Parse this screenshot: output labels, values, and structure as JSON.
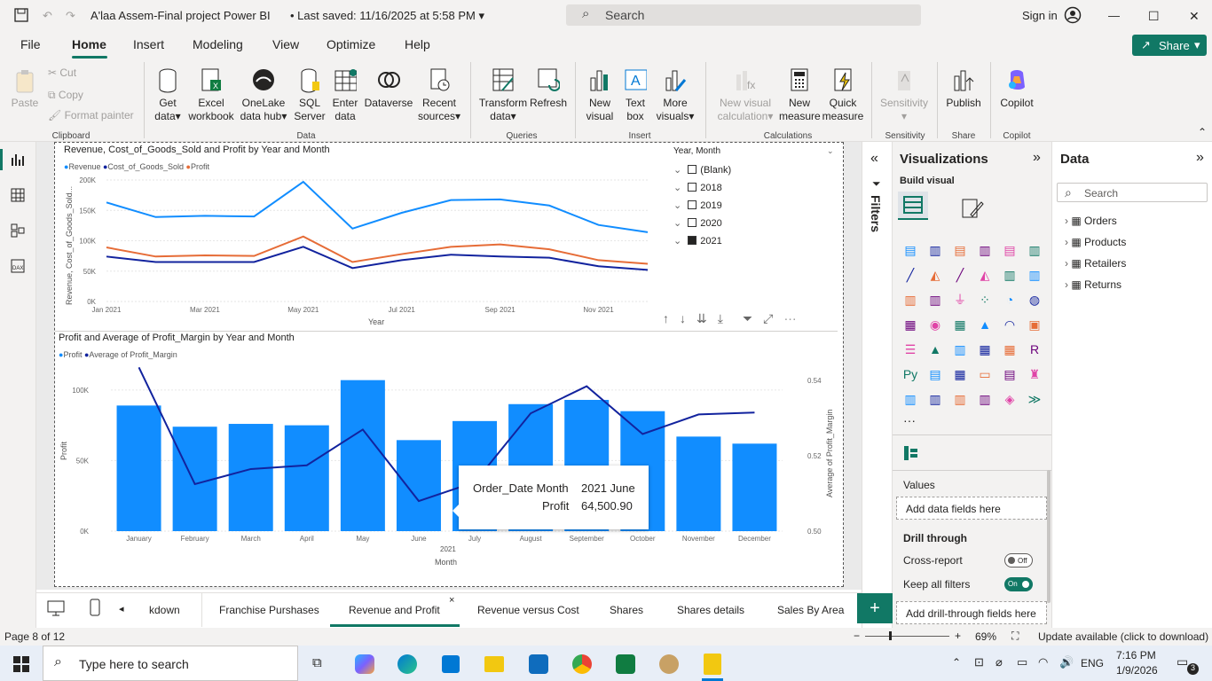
{
  "titlebar": {
    "title": "A'laa Assem-Final project Power BI",
    "saved": "Last saved: 11/16/2025 at 5:58 PM",
    "search_placeholder": "Search",
    "sign_in": "Sign in"
  },
  "menu": [
    "File",
    "Home",
    "Insert",
    "Modeling",
    "View",
    "Optimize",
    "Help"
  ],
  "share_label": "Share",
  "ribbon": {
    "clipboard": {
      "paste": "Paste",
      "cut": "Cut",
      "copy": "Copy",
      "format_painter": "Format painter",
      "group": "Clipboard"
    },
    "data": {
      "get_data_1": "Get",
      "get_data_2": "data",
      "excel_1": "Excel",
      "excel_2": "workbook",
      "onelake_1": "OneLake",
      "onelake_2": "data hub",
      "sql_1": "SQL",
      "sql_2": "Server",
      "enter_1": "Enter",
      "enter_2": "data",
      "dataverse": "Dataverse",
      "recent_1": "Recent",
      "recent_2": "sources",
      "group": "Data"
    },
    "queries": {
      "transform_1": "Transform",
      "transform_2": "data",
      "refresh": "Refresh",
      "group": "Queries"
    },
    "insert": {
      "new_visual_1": "New",
      "new_visual_2": "visual",
      "text_box_1": "Text",
      "text_box_2": "box",
      "more_visuals_1": "More",
      "more_visuals_2": "visuals",
      "group": "Insert"
    },
    "calculations": {
      "new_calc_1": "New visual",
      "new_calc_2": "calculation",
      "new_measure_1": "New",
      "new_measure_2": "measure",
      "quick_measure_1": "Quick",
      "quick_measure_2": "measure",
      "group": "Calculations"
    },
    "sensitivity": {
      "label": "Sensitivity",
      "group": "Sensitivity"
    },
    "share": {
      "publish": "Publish",
      "group": "Share"
    },
    "copilot": {
      "label": "Copilot",
      "group": "Copilot"
    }
  },
  "line_chart": {
    "title": "Revenue, Cost_of_Goods_Sold and Profit by Year and Month",
    "legend": [
      "Revenue",
      "Cost_of_Goods_Sold",
      "Profit"
    ],
    "colors": [
      "#118DFF",
      "#12239E",
      "#E66C37"
    ],
    "ylabel": "Revenue, Cost_of_Goods_Sold...",
    "xlabel": "Year",
    "yticks": [
      "200K",
      "150K",
      "100K",
      "50K",
      "0K"
    ],
    "xticks": [
      "Jan 2021",
      "Mar 2021",
      "May 2021",
      "Jul 2021",
      "Sep 2021",
      "Nov 2021"
    ]
  },
  "slicer": {
    "title": "Year, Month",
    "items": [
      {
        "label": "(Blank)",
        "checked": false
      },
      {
        "label": "2018",
        "checked": false
      },
      {
        "label": "2019",
        "checked": false
      },
      {
        "label": "2020",
        "checked": false
      },
      {
        "label": "2021",
        "checked": true
      }
    ]
  },
  "combo_chart": {
    "title": "Profit and Average of Profit_Margin by Year and Month",
    "legend": [
      "Profit",
      "Average of Profit_Margin"
    ],
    "ylabel": "Profit",
    "y2label": "Average of Profit_Margin",
    "xlabel": "Month",
    "year_label": "2021",
    "yticks": [
      "100K",
      "50K",
      "0K"
    ],
    "y2ticks": [
      "0.54",
      "0.52",
      "0.50"
    ]
  },
  "tooltip": {
    "k1": "Order_Date Month",
    "v1": "2021 June",
    "k2": "Profit",
    "v2": "64,500.90"
  },
  "chart_data": [
    {
      "type": "line",
      "title": "Revenue, Cost_of_Goods_Sold and Profit by Year and Month",
      "x": [
        "Jan 2021",
        "Feb 2021",
        "Mar 2021",
        "Apr 2021",
        "May 2021",
        "Jun 2021",
        "Jul 2021",
        "Aug 2021",
        "Sep 2021",
        "Oct 2021",
        "Nov 2021",
        "Dec 2021"
      ],
      "ylim": [
        0,
        200000
      ],
      "series": [
        {
          "name": "Revenue",
          "values": [
            163000,
            139000,
            141000,
            140000,
            197000,
            120000,
            146000,
            167000,
            168000,
            158000,
            126000,
            114000
          ]
        },
        {
          "name": "Cost_of_Goods_Sold",
          "values": [
            74000,
            65000,
            65000,
            65000,
            90000,
            55000,
            68000,
            77000,
            74000,
            72000,
            58000,
            52000
          ]
        },
        {
          "name": "Profit",
          "values": [
            89000,
            74000,
            76000,
            75000,
            107000,
            65000,
            78000,
            90000,
            94000,
            86000,
            68000,
            62000
          ]
        }
      ]
    },
    {
      "type": "bar",
      "title": "Profit and Average of Profit_Margin by Year and Month",
      "categories": [
        "January",
        "February",
        "March",
        "April",
        "May",
        "June",
        "July",
        "August",
        "September",
        "October",
        "November",
        "December"
      ],
      "ylim": [
        0,
        120000
      ],
      "y2lim": [
        0.5,
        0.545
      ],
      "series": [
        {
          "name": "Profit",
          "values": [
            89000,
            74000,
            76000,
            75000,
            107000,
            64500.9,
            78000,
            90000,
            93000,
            85000,
            67000,
            62000
          ]
        },
        {
          "name": "Average of Profit_Margin",
          "values": [
            0.5435,
            0.5125,
            0.5165,
            0.5175,
            0.527,
            0.508,
            0.513,
            0.5313,
            0.5385,
            0.5258,
            0.531,
            0.5315
          ]
        }
      ]
    }
  ],
  "filters_label": "Filters",
  "viz": {
    "title": "Visualizations",
    "build_visual": "Build visual",
    "values": "Values",
    "add_fields": "Add data fields here",
    "drill_through": "Drill through",
    "cross_report": "Cross-report",
    "cross_state": "Off",
    "keep_filters": "Keep all filters",
    "keep_state": "On",
    "add_drill": "Add drill-through fields here"
  },
  "data_pane": {
    "title": "Data",
    "search": "Search",
    "tables": [
      "Orders",
      "Products",
      "Retailers",
      "Returns"
    ]
  },
  "tabs": [
    "kdown",
    "Franchise Purshases",
    "Revenue and Profit",
    "Revenue versus Cost",
    "Shares",
    "Shares details",
    "Sales By Area"
  ],
  "status": {
    "page": "Page 8 of 12",
    "zoom": "69%",
    "update": "Update available (click to download)"
  },
  "taskbar": {
    "search": "Type here to search",
    "lang": "ENG",
    "time": "7:16 PM",
    "date": "1/9/2026",
    "badge": "3"
  }
}
